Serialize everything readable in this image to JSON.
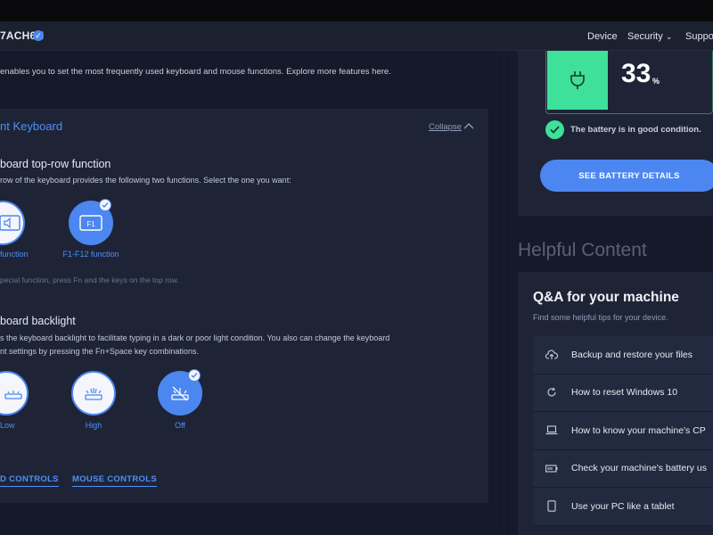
{
  "header": {
    "device_name": "7ACH6H",
    "nav": [
      "Device",
      "Security",
      "Suppo"
    ]
  },
  "main": {
    "intro": "enables you to set the most frequently used keyboard and mouse functions. Explore more features here.",
    "card_title": "nt Keyboard",
    "collapse_label": "Collapse",
    "toprow": {
      "title": "board top-row function",
      "desc": "row of the keyboard provides the following two functions. Select the one you want:",
      "options": [
        {
          "label": "function",
          "icon": "special-function-icon",
          "selected": false
        },
        {
          "label": "F1-F12 function",
          "icon": "f1-key-icon",
          "key_text": "F1",
          "selected": true
        }
      ],
      "note": "pecial function, press Fn and the keys on the top row."
    },
    "backlight": {
      "title": "board backlight",
      "desc_line1": "s the keyboard backlight to facilitate typing in a dark or poor light condition. You also can change the keyboard",
      "desc_line2": "nt settings by pressing the Fn+Space key combinations.",
      "options": [
        {
          "label": "Low",
          "icon": "backlight-low-icon",
          "selected": false
        },
        {
          "label": "High",
          "icon": "backlight-high-icon",
          "selected": false
        },
        {
          "label": "Off",
          "icon": "backlight-off-icon",
          "selected": true
        }
      ]
    },
    "bottom_links": [
      "D CONTROLS",
      "MOUSE CONTROLS"
    ]
  },
  "battery": {
    "percent": "33",
    "percent_symbol": "%",
    "status": "The battery is in good condition.",
    "button": "SEE BATTERY DETAILS"
  },
  "helpful": {
    "title": "Helpful Content",
    "qa_title": "Q&A for your machine",
    "qa_subtitle": "Find some helpful tips for your device.",
    "items": [
      {
        "label": "Backup and restore your files",
        "icon": "cloud-upload-icon"
      },
      {
        "label": "How to reset Windows 10",
        "icon": "refresh-icon"
      },
      {
        "label": "How to know your machine's CP",
        "icon": "laptop-icon"
      },
      {
        "label": "Check your machine's battery us",
        "icon": "battery-icon"
      },
      {
        "label": "Use your PC like a tablet",
        "icon": "tablet-icon"
      }
    ]
  },
  "colors": {
    "accent": "#4c86f0",
    "battery_green": "#3ee09a",
    "background": "#15192a",
    "card": "#1e2436"
  }
}
